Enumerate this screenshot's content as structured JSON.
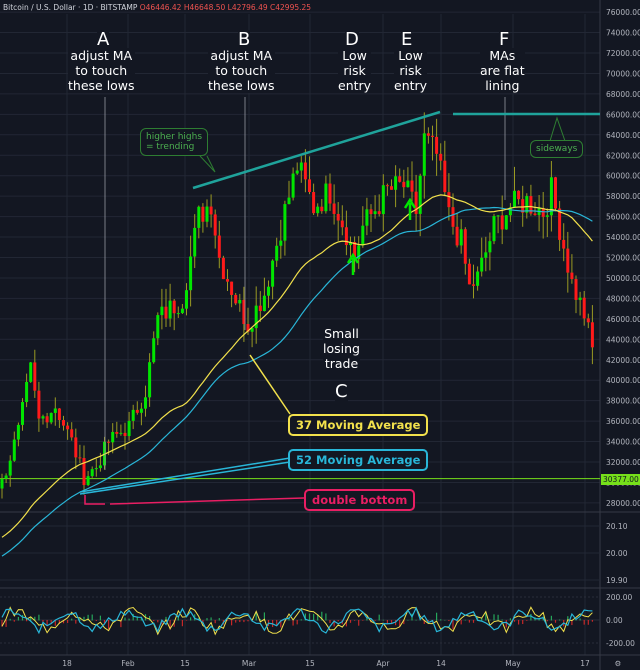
{
  "header": {
    "symbol": "Bitcoin / U.S. Dollar",
    "interval": "1D",
    "exchange": "BITSTAMP",
    "open": "O46446.42",
    "high": "H46648.50",
    "low": "L42796.49",
    "close": "C42995.25"
  },
  "price_tag": "30377.00",
  "lower_axis_1": [
    "20.10",
    "20.00",
    "19.90"
  ],
  "lower_axis_2": [
    "200.00",
    "0.00",
    "-200.00"
  ],
  "time_labels": [
    "18",
    "Feb",
    "15",
    "Mar",
    "15",
    "Apr",
    "14",
    "May",
    "17"
  ],
  "annotations": {
    "A": {
      "letter": "A",
      "text": "adjust MA\nto touch\nthese lows"
    },
    "B": {
      "letter": "B",
      "text": "adjust MA\nto touch\nthese lows"
    },
    "C": {
      "letter": "C",
      "text": "Small\nlosing\ntrade"
    },
    "D": {
      "letter": "D",
      "text": "Low\nrisk\nentry"
    },
    "E": {
      "letter": "E",
      "text": "Low\nrisk\nentry"
    },
    "F": {
      "letter": "F",
      "text": "MAs\nare flat\nlining"
    },
    "higher_highs": "higher highs\n= trending",
    "sideways": "sideways",
    "ma37": "37 Moving Average",
    "ma52": "52 Moving Average",
    "double_bottom": "double bottom"
  },
  "colors": {
    "bg": "#131722",
    "up": "#00e600",
    "down": "#ff1a1a",
    "wick": "#9a9a22",
    "ma37": "#f2e14c",
    "ma52": "#29b6d8",
    "trend": "#1fa39b",
    "pink": "#e91e63"
  },
  "chart_data": {
    "type": "candlestick",
    "y_ticks": [
      28000,
      30000,
      32000,
      34000,
      36000,
      38000,
      40000,
      42000,
      44000,
      46000,
      48000,
      50000,
      52000,
      54000,
      56000,
      58000,
      60000,
      62000,
      64000,
      66000,
      68000,
      70000,
      72000,
      74000,
      76000
    ],
    "ylim": [
      27000,
      77000
    ],
    "keyframes_day_price": [
      [
        -70,
        13500
      ],
      [
        -40,
        19000
      ],
      [
        -20,
        23500
      ],
      [
        -5,
        29000
      ],
      [
        0,
        30000
      ],
      [
        4,
        35000
      ],
      [
        7,
        41000
      ],
      [
        9,
        36000
      ],
      [
        13,
        37500
      ],
      [
        17,
        34000
      ],
      [
        20,
        30500
      ],
      [
        23,
        31500
      ],
      [
        26,
        34000
      ],
      [
        31,
        35500
      ],
      [
        35,
        39000
      ],
      [
        38,
        46000
      ],
      [
        44,
        48000
      ],
      [
        48,
        56000
      ],
      [
        51,
        57500
      ],
      [
        53,
        52000
      ],
      [
        57,
        48000
      ],
      [
        60,
        45500
      ],
      [
        64,
        48500
      ],
      [
        68,
        55000
      ],
      [
        72,
        61000
      ],
      [
        76,
        57000
      ],
      [
        80,
        58500
      ],
      [
        84,
        54500
      ],
      [
        86,
        52000
      ],
      [
        88,
        55000
      ],
      [
        94,
        58500
      ],
      [
        98,
        59000
      ],
      [
        101,
        56500
      ],
      [
        103,
        63500
      ],
      [
        106,
        62000
      ],
      [
        109,
        56000
      ],
      [
        112,
        53500
      ],
      [
        114,
        49000
      ],
      [
        116,
        50000
      ],
      [
        120,
        55000
      ],
      [
        124,
        57000
      ],
      [
        128,
        57500
      ],
      [
        132,
        56500
      ],
      [
        134,
        58500
      ],
      [
        136,
        55000
      ],
      [
        139,
        49500
      ],
      [
        142,
        46500
      ],
      [
        144,
        43000
      ]
    ],
    "ma_periods": [
      37,
      52
    ]
  }
}
